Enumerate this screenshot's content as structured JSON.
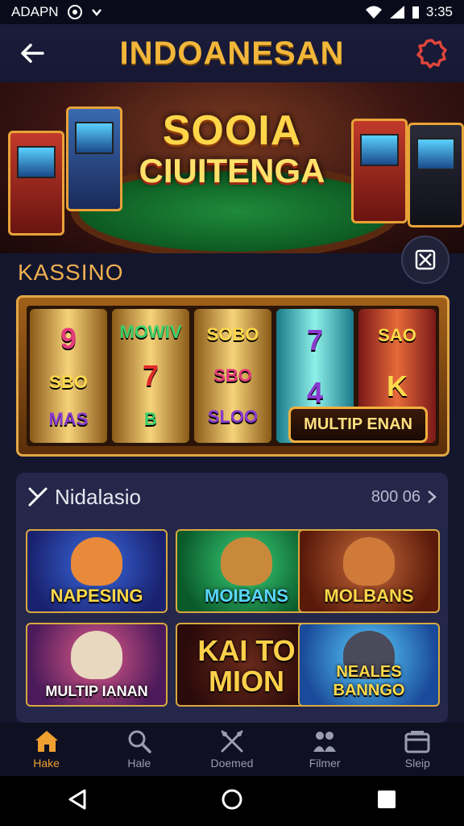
{
  "status_bar": {
    "carrier": "ADAPN",
    "time": "3:35"
  },
  "header": {
    "title": "INDOANESAN"
  },
  "hero": {
    "line1": "SOOIA",
    "line2": "CIUITENGA"
  },
  "section": {
    "title": "KASSINO"
  },
  "slot": {
    "reels": [
      [
        "9",
        "SBO",
        "MAS"
      ],
      [
        "MOWIV",
        "7",
        "B"
      ],
      [
        "SOBO",
        "SBO",
        "SLOO"
      ],
      [
        "7",
        "4",
        ""
      ],
      [
        "SAO",
        "K",
        ""
      ]
    ],
    "banner": "MULTIP ENAN"
  },
  "games": {
    "title": "Nidalasio",
    "more": "800 06",
    "cards": [
      {
        "label": "NAPESING"
      },
      {
        "label": "MOIBANS"
      },
      {
        "label": "MOLBANS"
      },
      {
        "label": "MULTIP IANAN"
      },
      {
        "label": "KAI TO MION"
      },
      {
        "label": "NEALES BANNGO"
      }
    ]
  },
  "nav": {
    "items": [
      {
        "label": "Hake",
        "icon": "home-icon",
        "active": true
      },
      {
        "label": "Hale",
        "icon": "search-icon",
        "active": false
      },
      {
        "label": "Doemed",
        "icon": "crossed-tools-icon",
        "active": false
      },
      {
        "label": "Filmer",
        "icon": "people-icon",
        "active": false
      },
      {
        "label": "Sleip",
        "icon": "wallet-icon",
        "active": false
      }
    ]
  },
  "colors": {
    "accent": "#f0a030",
    "title_gold": "#f2b73a",
    "background": "#14162e"
  }
}
